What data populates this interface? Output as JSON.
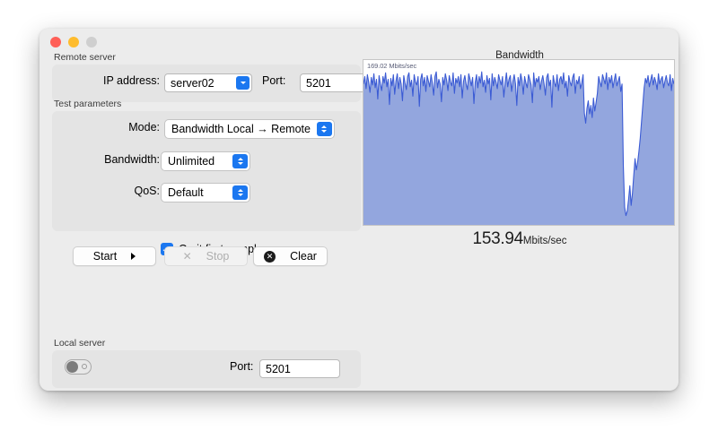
{
  "window": {
    "traffic_lights": [
      "close",
      "minimize",
      "zoom"
    ]
  },
  "remote_server": {
    "group_label": "Remote server",
    "ip_label": "IP address:",
    "ip_value": "server02",
    "port_label": "Port:",
    "port_value": "5201"
  },
  "test_parameters": {
    "group_label": "Test parameters",
    "mode_label": "Mode:",
    "mode_value": "Bandwidth Local → Remote",
    "bandwidth_label": "Bandwidth:",
    "bandwidth_value": "Unlimited",
    "qos_label": "QoS:",
    "qos_value": "Default",
    "omit_label": "Omit first samples",
    "omit_checked": true
  },
  "actions": {
    "start_label": "Start",
    "stop_label": "Stop",
    "clear_label": "Clear",
    "clear_icon": "circle-x-icon",
    "start_icon": "chevron-right-icon",
    "stop_icon": "x-icon",
    "stop_disabled": true
  },
  "local_server": {
    "group_label": "Local server",
    "toggle_on": false,
    "port_label": "Port:",
    "port_value": "5201"
  },
  "result": {
    "value": "153.94",
    "unit": "Mbits/sec"
  },
  "colors": {
    "accent": "#1b77f0",
    "chart_fill": "#93a6de",
    "chart_stroke": "#3b5bd4",
    "window_bg": "#ececec",
    "group_bg": "#e4e4e4"
  },
  "chart_data": {
    "type": "area",
    "title": "Bandwidth",
    "scale_label": "169.02 Mbits/sec",
    "ylabel": "Mbits/sec",
    "xlabel": "",
    "ylim": [
      0,
      169.02
    ],
    "grid": false,
    "legend": false,
    "series": [
      {
        "name": "Bandwidth",
        "values": [
          150,
          158,
          145,
          160,
          152,
          141,
          157,
          149,
          161,
          146,
          155,
          134,
          159,
          150,
          143,
          158,
          151,
          162,
          147,
          155,
          128,
          156,
          148,
          160,
          139,
          153,
          161,
          145,
          157,
          150,
          132,
          159,
          151,
          144,
          158,
          162,
          147,
          154,
          137,
          160,
          152,
          149,
          158,
          126,
          155,
          161,
          148,
          157,
          142,
          159,
          153,
          147,
          160,
          151,
          138,
          158,
          163,
          146,
          155,
          150,
          131,
          157,
          149,
          161,
          154,
          143,
          159,
          152,
          148,
          162,
          140,
          156,
          151,
          158,
          147,
          160,
          135,
          153,
          159,
          150,
          144,
          161,
          155,
          148,
          157,
          129,
          152,
          160,
          146,
          158,
          151,
          163,
          147,
          154,
          141,
          159,
          150,
          156,
          133,
          161,
          148,
          157,
          152,
          145,
          160,
          154,
          149,
          158,
          136,
          151,
          162,
          147,
          155,
          159,
          142,
          153,
          160,
          150,
          127,
          157,
          148,
          161,
          154,
          139,
          158,
          151,
          146,
          160,
          155,
          149,
          130,
          162,
          147,
          156,
          152,
          158,
          144,
          153,
          159,
          150,
          138,
          157,
          161,
          148,
          154,
          125,
          159,
          151,
          147,
          160,
          143,
          155,
          158,
          150,
          162,
          146,
          153,
          137,
          159,
          152,
          148,
          157,
          161,
          140,
          154,
          150,
          158,
          145,
          151,
          160,
          119,
          108,
          124,
          132,
          118,
          127,
          114,
          135,
          121,
          130,
          140,
          158,
          152,
          147,
          160,
          155,
          150,
          162,
          144,
          157,
          151,
          159,
          146,
          154,
          161,
          148,
          153,
          158,
          142,
          150,
          62,
          18,
          9,
          14,
          26,
          41,
          20,
          33,
          52,
          70,
          58,
          66,
          78,
          92,
          110,
          128,
          146,
          156,
          151,
          159,
          147,
          154,
          160,
          149,
          157,
          152,
          144,
          161,
          150,
          155,
          158,
          146,
          153,
          159,
          151,
          148,
          160,
          143,
          156,
          150
        ]
      }
    ]
  }
}
